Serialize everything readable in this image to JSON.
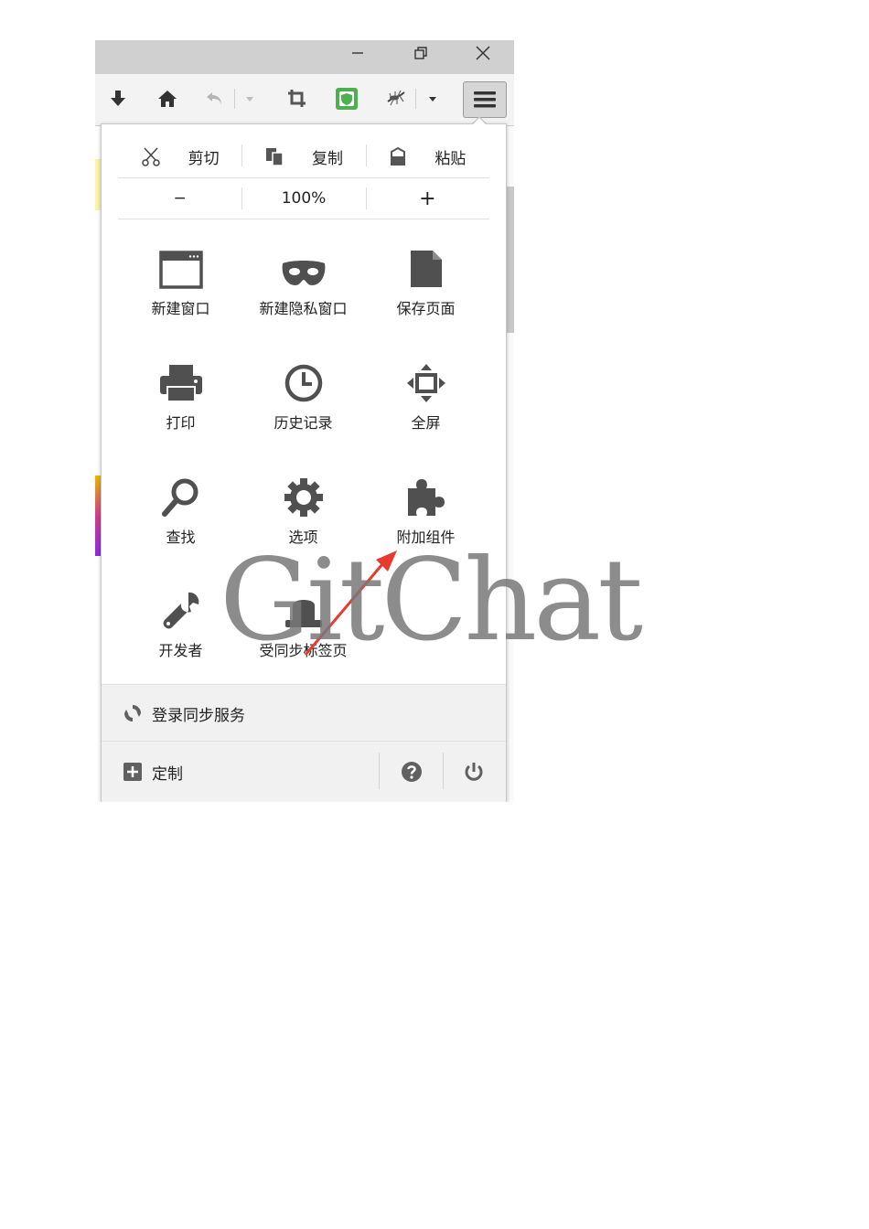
{
  "window": {
    "controls": [
      {
        "name": "minimize-icon"
      },
      {
        "name": "restore-icon"
      },
      {
        "name": "close-icon"
      }
    ]
  },
  "toolbar": {
    "icons": [
      "download-icon",
      "home-icon",
      "undo-icon",
      "dropdown-icon",
      "crop-icon",
      "shield-addon-icon",
      "mosquito-addon-icon",
      "dropdown-icon",
      "hamburger-menu-icon"
    ]
  },
  "panel": {
    "edit": {
      "cut": "剪切",
      "copy": "复制",
      "paste": "粘贴"
    },
    "zoom": {
      "minus": "−",
      "level": "100%",
      "plus": "+"
    },
    "items": [
      {
        "label": "新建窗口",
        "icon": "new-window-icon"
      },
      {
        "label": "新建隐私窗口",
        "icon": "private-mask-icon"
      },
      {
        "label": "保存页面",
        "icon": "save-page-icon"
      },
      {
        "label": "打印",
        "icon": "printer-icon"
      },
      {
        "label": "历史记录",
        "icon": "history-clock-icon"
      },
      {
        "label": "全屏",
        "icon": "fullscreen-icon"
      },
      {
        "label": "查找",
        "icon": "search-icon"
      },
      {
        "label": "选项",
        "icon": "gear-icon"
      },
      {
        "label": "附加组件",
        "icon": "puzzle-addons-icon"
      },
      {
        "label": "开发者",
        "icon": "wrench-icon"
      },
      {
        "label": "受同步标签页",
        "icon": "synced-tabs-icon"
      }
    ],
    "sync": {
      "label": "登录同步服务"
    },
    "customize": {
      "label": "定制"
    },
    "help_icon": "help-icon",
    "quit_icon": "power-icon"
  },
  "watermark": {
    "text": "GitChat"
  },
  "colors": {
    "icon": "#505050",
    "titlebar": "#d0d0d0",
    "toolbar": "#f3f3f3",
    "annotation_arrow": "#e83a2e",
    "shield_green": "#4caf50"
  }
}
